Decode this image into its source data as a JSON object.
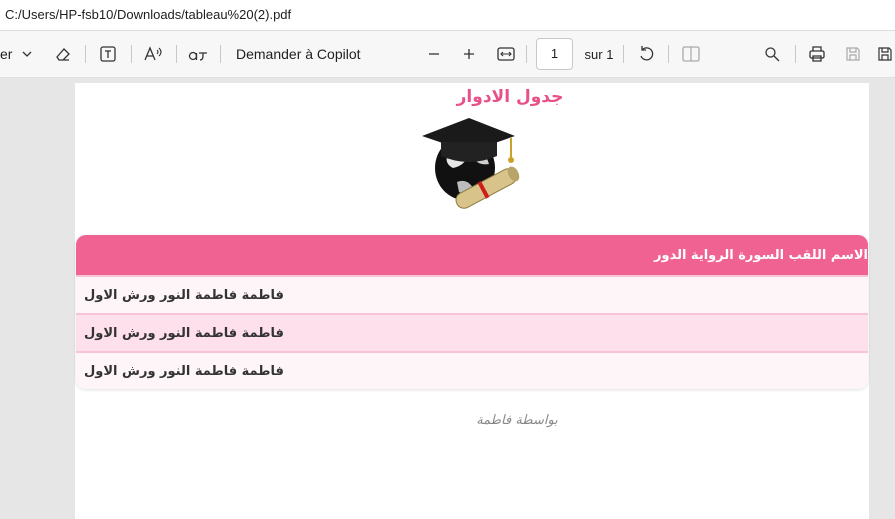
{
  "address_bar": {
    "path": "C:/Users/HP-fsb10/Downloads/tableau%20(2).pdf"
  },
  "toolbar": {
    "partial_label": "er",
    "copilot_label": "Demander à Copilot",
    "page_current": "1",
    "page_total_label": "sur 1",
    "icons": [
      "chevron-down-icon",
      "eraser-icon",
      "text-box-icon",
      "read-aloud-icon",
      "translate-icon",
      "zoom-out-icon",
      "zoom-in-icon",
      "fit-width-icon",
      "rotate-icon",
      "page-view-icon",
      "search-icon",
      "print-icon",
      "save-icon",
      "save-as-icon"
    ]
  },
  "document": {
    "title": "جدول الادوار",
    "table": {
      "header": "الاسم اللقب السورة الرواية الدور",
      "rows": [
        "فاطمة فاطمة النور ورش الاول",
        "فاطمة فاطمة النور ورش الاول",
        "فاطمة فاطمة النور ورش الاول"
      ]
    },
    "footer": "بواسطة فاطمة"
  },
  "colors": {
    "accent": "#f06292",
    "title": "#e8508a",
    "row_odd": "#fdf5f7",
    "row_even": "#fde0eb"
  }
}
